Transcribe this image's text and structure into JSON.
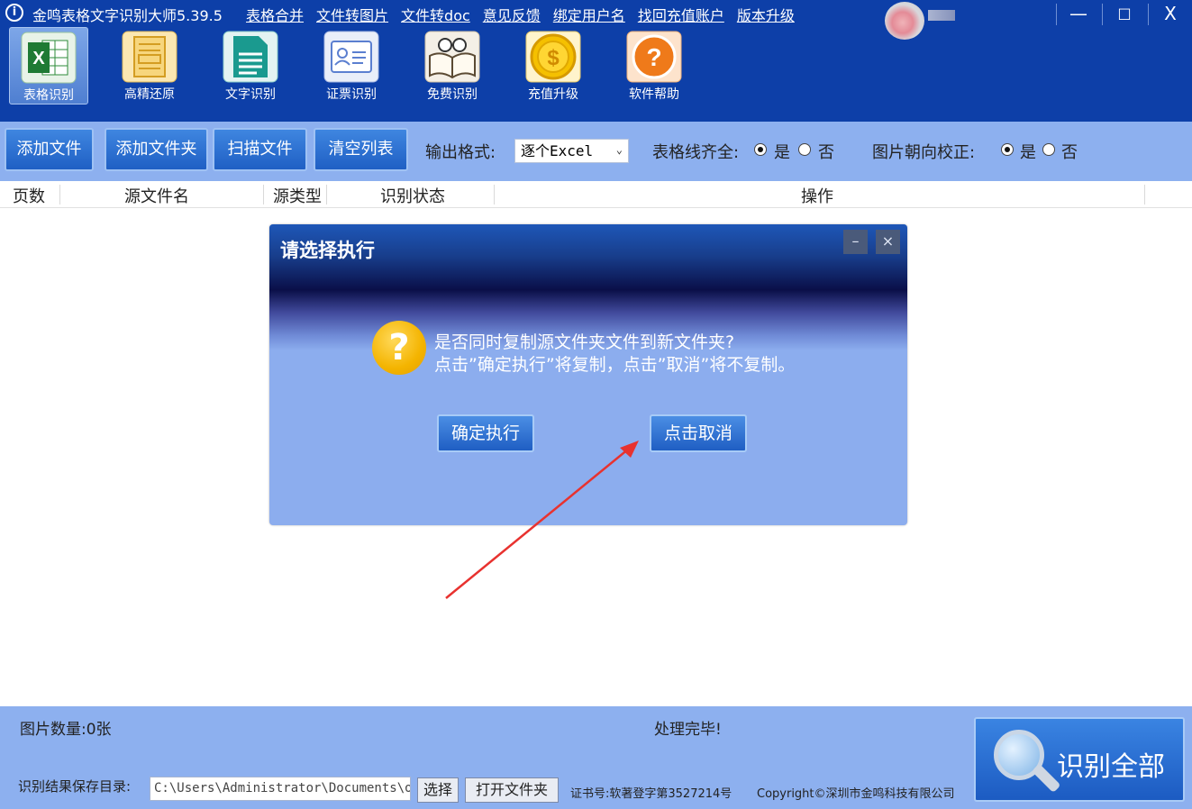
{
  "titlebar": {
    "app_title": "金鸣表格文字识别大师5.39.5",
    "links": [
      "表格合并",
      "文件转图片",
      "文件转doc",
      "意见反馈",
      "绑定用户名",
      "找回充值账户",
      "版本升级"
    ],
    "minimize": "—",
    "maximize": "□",
    "close": "X"
  },
  "toolbar_icons": [
    {
      "label": "表格识别",
      "icon": "excel-icon",
      "color": "#2e8b3a"
    },
    {
      "label": "高精还原",
      "icon": "document-layout-icon",
      "color": "#f2c14e"
    },
    {
      "label": "文字识别",
      "icon": "text-document-icon",
      "color": "#1a9a8f"
    },
    {
      "label": "证票识别",
      "icon": "id-card-icon",
      "color": "#5b7fd0"
    },
    {
      "label": "免费识别",
      "icon": "book-glasses-icon",
      "color": "#c9b28a"
    },
    {
      "label": "充值升级",
      "icon": "dollar-coin-icon",
      "color": "#f2b600"
    },
    {
      "label": "软件帮助",
      "icon": "help-icon",
      "color": "#ef7a1a"
    }
  ],
  "toolbar2": {
    "add_file": "添加文件",
    "add_folder": "添加文件夹",
    "scan_file": "扫描文件",
    "clear_list": "清空列表",
    "output_format_label": "输出格式:",
    "output_format_value": "逐个Excel",
    "table_line_label": "表格线齐全:",
    "yes": "是",
    "no": "否",
    "orientation_label": "图片朝向校正:"
  },
  "table": {
    "columns": [
      "页数",
      "源文件名",
      "源类型",
      "识别状态",
      "操作"
    ]
  },
  "dialog": {
    "title": "请选择执行",
    "line1": "是否同时复制源文件夹文件到新文件夹?",
    "line2": "点击”确定执行”将复制，点击”取消”将不复制。",
    "confirm": "确定执行",
    "cancel": "点击取消",
    "minimize": "–",
    "close": "×"
  },
  "status": {
    "image_count": "图片数量:0张",
    "processing": "处理完毕!",
    "save_dir_label": "识别结果保存目录:",
    "save_dir_value": "C:\\Users\\Administrator\\Documents\\oc",
    "choose": "选择",
    "open_folder": "打开文件夹",
    "certificate": "证书号:软著登字第3527214号",
    "copyright": "Copyright©深圳市金鸣科技有限公司",
    "recognize_all": "识别全部"
  }
}
